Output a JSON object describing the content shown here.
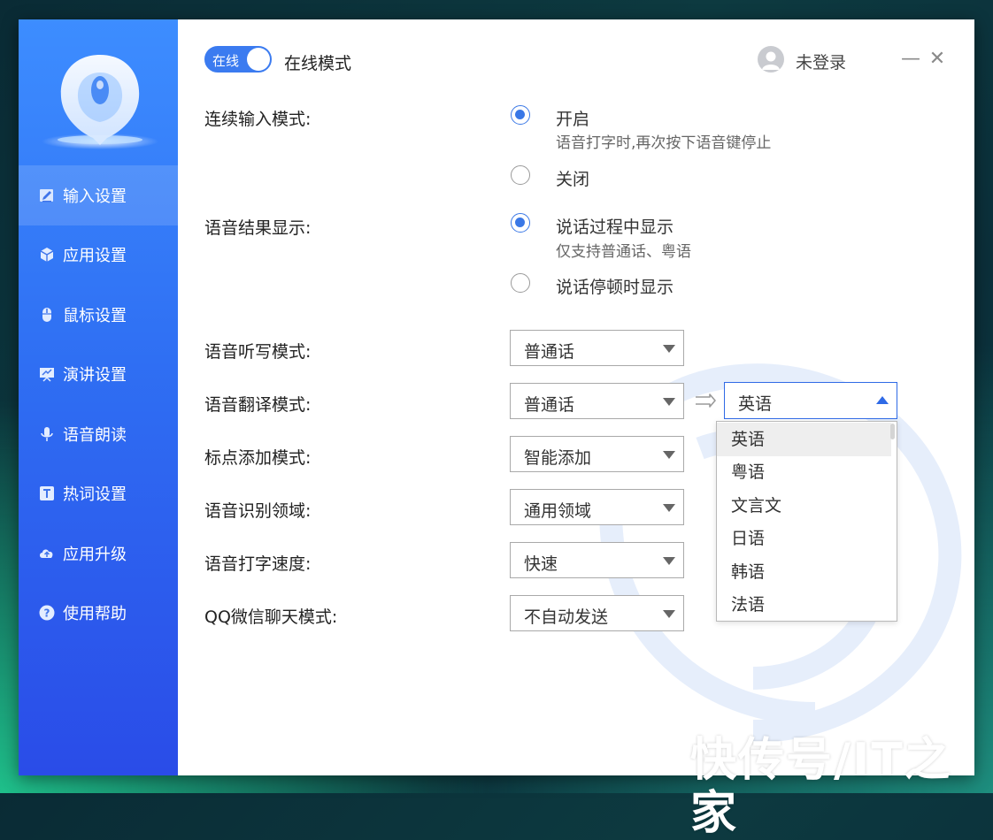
{
  "sidebar": {
    "items": [
      {
        "label": "输入设置",
        "icon": "edit-icon",
        "active": true
      },
      {
        "label": "应用设置",
        "icon": "cube-icon"
      },
      {
        "label": "鼠标设置",
        "icon": "mouse-icon"
      },
      {
        "label": "演讲设置",
        "icon": "presentation-icon"
      },
      {
        "label": "语音朗读",
        "icon": "microphone-icon"
      },
      {
        "label": "热词设置",
        "icon": "text-t-icon"
      },
      {
        "label": "应用升级",
        "icon": "cloud-upload-icon"
      },
      {
        "label": "使用帮助",
        "icon": "help-icon"
      }
    ]
  },
  "header": {
    "toggle_label": "在线",
    "toggle_on": true,
    "mode_label": "在线模式",
    "user_label": "未登录",
    "minimize": "—",
    "close": "✕"
  },
  "continuous": {
    "label": "连续输入模式:",
    "options": [
      {
        "label": "开启",
        "sub": "语音打字时,再次按下语音键停止",
        "checked": true
      },
      {
        "label": "关闭",
        "checked": false
      }
    ]
  },
  "result_display": {
    "label": "语音结果显示:",
    "options": [
      {
        "label": "说话过程中显示",
        "sub": "仅支持普通话、粤语",
        "checked": true
      },
      {
        "label": "说话停顿时显示",
        "checked": false
      }
    ]
  },
  "settings": [
    {
      "label": "语音听写模式:",
      "value": "普通话"
    },
    {
      "label": "语音翻译模式:",
      "value": "普通话"
    },
    {
      "label": "标点添加模式:",
      "value": "智能添加"
    },
    {
      "label": "语音识别领域:",
      "value": "通用领域"
    },
    {
      "label": "语音打字速度:",
      "value": "快速"
    },
    {
      "label": "QQ微信聊天模式:",
      "value": "不自动发送"
    }
  ],
  "translate_target": {
    "value": "英语",
    "options": [
      "英语",
      "粤语",
      "文言文",
      "日语",
      "韩语",
      "法语"
    ],
    "hovered": "英语"
  },
  "watermark": "快传号/IT之家",
  "colors": {
    "accent": "#3a78e6",
    "sidebar_top": "#3d8dff",
    "sidebar_bottom": "#2a4ce8"
  }
}
